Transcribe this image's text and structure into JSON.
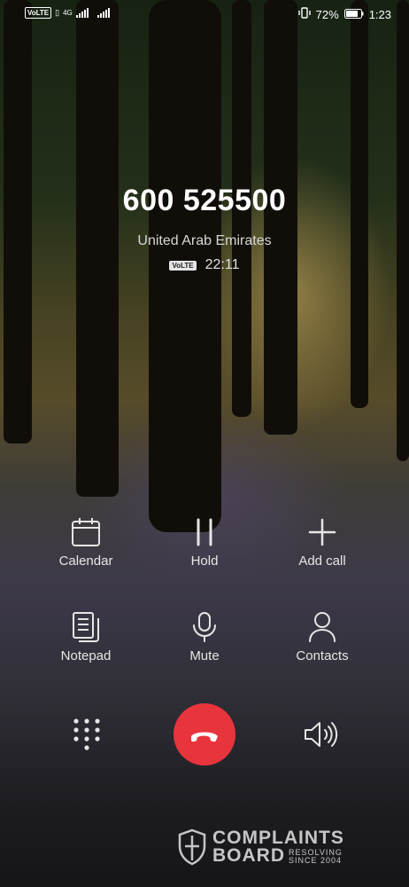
{
  "status_bar": {
    "volte": "VoLTE",
    "network": "4G",
    "battery": "72%",
    "time": "1:23"
  },
  "call": {
    "number": "600 525500",
    "location": "United Arab Emirates",
    "volte_tag": "VoLTE",
    "duration": "22:11"
  },
  "actions": [
    {
      "label": "Calendar",
      "icon": "calendar-icon"
    },
    {
      "label": "Hold",
      "icon": "pause-icon"
    },
    {
      "label": "Add call",
      "icon": "plus-icon"
    },
    {
      "label": "Notepad",
      "icon": "notepad-icon"
    },
    {
      "label": "Mute",
      "icon": "microphone-icon"
    },
    {
      "label": "Contacts",
      "icon": "person-icon"
    }
  ],
  "bottom": {
    "dialpad_icon": "dialpad-icon",
    "end_call_icon": "hang-up-icon",
    "end_call_color": "#e8343d",
    "speaker_icon": "speaker-icon"
  },
  "watermark": {
    "line1": "COMPLAINTS",
    "line2": "BOARD",
    "tag1": "RESOLVING",
    "tag2": "SINCE 2004"
  }
}
